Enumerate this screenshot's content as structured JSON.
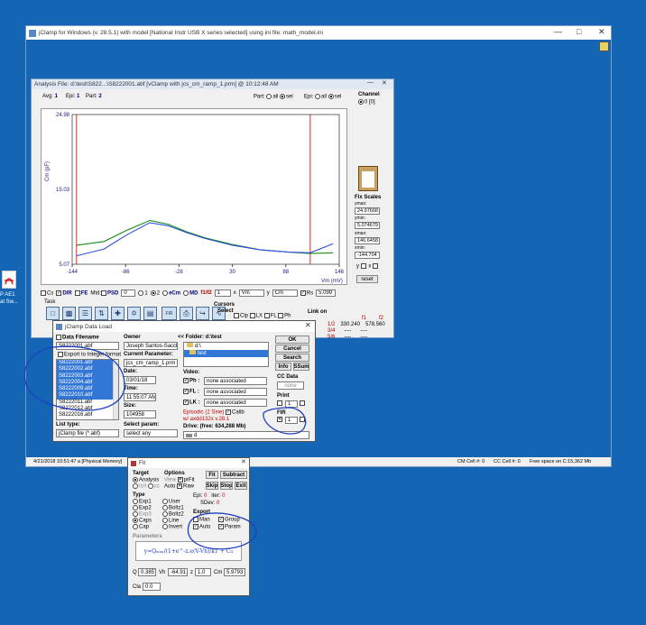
{
  "desktop": {
    "icon_label_1": "P AE1",
    "icon_label_2": "at Sw..."
  },
  "main_window": {
    "title": "jClamp for Windows (v. 28.5.1) with model [National Instr USB X series selected] using ini file: math_model.ini",
    "status": [
      "4/21/2018 10:51:47 a [Physical Memory]",
      "CM Cell #: 0",
      "CC Cell #: 0",
      "Free space on C:15,362 Mb"
    ]
  },
  "analysis_window": {
    "title": "Analysis File: d:\\test\\S822...\\S8222001.abf [vClamp with jcs_cm_ramp_1.prm] @ 10:12:48 AM",
    "avg_label": "Avg:",
    "avg_val": "1",
    "epi_label": "Epi:",
    "epi_val": "1",
    "part_label": "Part:",
    "part_val": "2",
    "part2_label": "Part:",
    "all": "all",
    "sel": "sel",
    "epi2_label": "Epi:",
    "channel_label": "Channel",
    "channel_val": "0 [0]",
    "fix_scales": "Fix Scales",
    "ymax_label": "ymax:",
    "ymax": "24.97668",
    "ymin_label": "ymin:",
    "ymin": "5.074679",
    "xmax_label": "xmax:",
    "xmax": "146.6458",
    "xmin_label": "xmin:",
    "xmin": "-144.704",
    "y_label": "y",
    "x_label": "x",
    "reset": "reset",
    "cs": "Cs",
    "dir": "DIR",
    "fe": "FE",
    "mtd": "Mtd:",
    "psd": "PSD",
    "psd_val": "0",
    "r1": "1",
    "r2": "2",
    "ecm": "eCm",
    "md": "MD",
    "f1f2": "f1/f2",
    "sel_val": "1",
    "x_axis": "x",
    "x_axis_val": "Vm",
    "y_axis": "y",
    "y_axis_val": "Cm",
    "rs": "Rs",
    "rs_val": "5.099",
    "task": "Task",
    "cursors": "Cursors",
    "select": "Select",
    "clp": "Clp",
    "lx": "LX",
    "fl": "FL",
    "ph": "Ph",
    "link_on": "Link on",
    "link_rows": [
      [
        "1/2",
        "330.240",
        "578.560"
      ],
      [
        "3/4",
        "----",
        "----"
      ],
      [
        "5/6",
        "----",
        "----"
      ]
    ],
    "link_hdr": [
      "f1",
      "f2"
    ],
    "fir": "FIR"
  },
  "chart_data": {
    "type": "line",
    "ylabel": "Cm (pF)",
    "xlabel": "Vm (mV)",
    "x_ticks": [
      "-144",
      "-86",
      "-28",
      "30",
      "88",
      "146"
    ],
    "y_ticks": [
      "24.98",
      "15.03",
      "5.07"
    ],
    "xlim": [
      -144.704,
      146.6458
    ],
    "ylim": [
      5.074679,
      24.97668
    ],
    "cursor_x": [
      -140,
      115
    ],
    "series": [
      {
        "color": "#1a8a1a",
        "x": [
          -140,
          -110,
          -85,
          -60,
          -40,
          -20,
          0,
          30,
          60,
          90,
          115,
          140
        ],
        "y": [
          7.6,
          8.1,
          9.6,
          10.9,
          10.4,
          9.4,
          8.6,
          7.7,
          7.0,
          6.7,
          6.5,
          6.6
        ]
      },
      {
        "color": "#3050e0",
        "x": [
          -140,
          -110,
          -85,
          -60,
          -40,
          -20,
          0,
          30,
          60,
          90,
          115,
          140
        ],
        "y": [
          6.2,
          7.1,
          9.0,
          10.6,
          10.2,
          9.3,
          8.5,
          7.6,
          7.0,
          6.7,
          6.6,
          7.8
        ]
      }
    ]
  },
  "data_load": {
    "title": "jClamp Data Load",
    "data_filename": "Data Filename",
    "filename_val": "S8222001.abf",
    "export_integer": "Export to Integer format",
    "files": [
      "S8222001.abf",
      "S8222002.abf",
      "S8222003.abf",
      "S8222004.abf",
      "S8222009.abf",
      "S8222010.abf",
      "S8222011.abf",
      "S8222012.abf",
      "S8222016.abf"
    ],
    "list_type": "List type:",
    "list_type_val": "jClamp file (*.abf)",
    "owner": "Owner",
    "owner_val": "Joseph Santos-Sacchi",
    "current_param": "Current Parameter:",
    "current_param_val": "jcs_cm_ramp_1.prm",
    "date": "Date:",
    "date_val": "03/01/18",
    "time": "Time:",
    "time_val": "11:55:07 AM",
    "size": "Size:",
    "size_val": "104958",
    "select_param": "Select param:",
    "select_param_val": "select any",
    "folder": "<< Folder: d:\\test",
    "folders": [
      "d:\\",
      "test"
    ],
    "video": "Video:",
    "ph": "Ph :",
    "fl": "FL :",
    "lk": "LK :",
    "none_assoc": "none associated",
    "episodic": "Episodic (2 Sine)",
    "calib": "Calib",
    "axdd": "w/ axdd132x v.28.1",
    "drive": "Drive: (free: 634,288 Mb)",
    "drive_val": "d",
    "ok": "OK",
    "cancel": "Cancel",
    "search": "Search",
    "info": "Info",
    "ssum": "SSum",
    "cc_data": "CC Data",
    "none": "none",
    "print": "Print",
    "print_val": "1",
    "fir": "FIR",
    "fir_val": "1"
  },
  "fit": {
    "title": "Fit",
    "target": "Target",
    "analysis": "Analysis",
    "isvt": "Is/t",
    "cc": "cc",
    "options": "Options",
    "view": "View",
    "prfit": "prFit",
    "auto": "Auto",
    "raw": "Raw",
    "fit_btn": "Fit",
    "subtract": "Subtract",
    "skip": "Skip",
    "stop": "Stop",
    "exit": "Exit",
    "type": "Type",
    "types": [
      "Exp1",
      "Exp2",
      "Exp3",
      "Caps",
      "Cap",
      "User",
      "Boltz1",
      "Boltz2",
      "Line",
      "Invert"
    ],
    "epi": "Epi:",
    "epi_val": "0",
    "iter": "iter:",
    "iter_val": "0",
    "sdev": "SDev:",
    "sdev_val": "0",
    "export": "Export",
    "man": "Man",
    "group": "Group",
    "auto_ex": "Auto",
    "param": "Param",
    "parameters": "Parameters",
    "formula": "y=Qₘₐₓ/(1+e^-z.e(V-Vh)/kT + Cₗₗ",
    "q": "Q",
    "q_val": "0.3857",
    "vh": "Vh",
    "vh_val": "-64.91",
    "z": "z",
    "z_val": "1.0",
    "cm": "Cm",
    "cm_val": "5.9793",
    "cla": "Cla",
    "cla_val": "0.0"
  },
  "colors": {
    "desktop": "#1466b4",
    "annotation": "#1f3fbf",
    "selection": "#3377d6"
  }
}
